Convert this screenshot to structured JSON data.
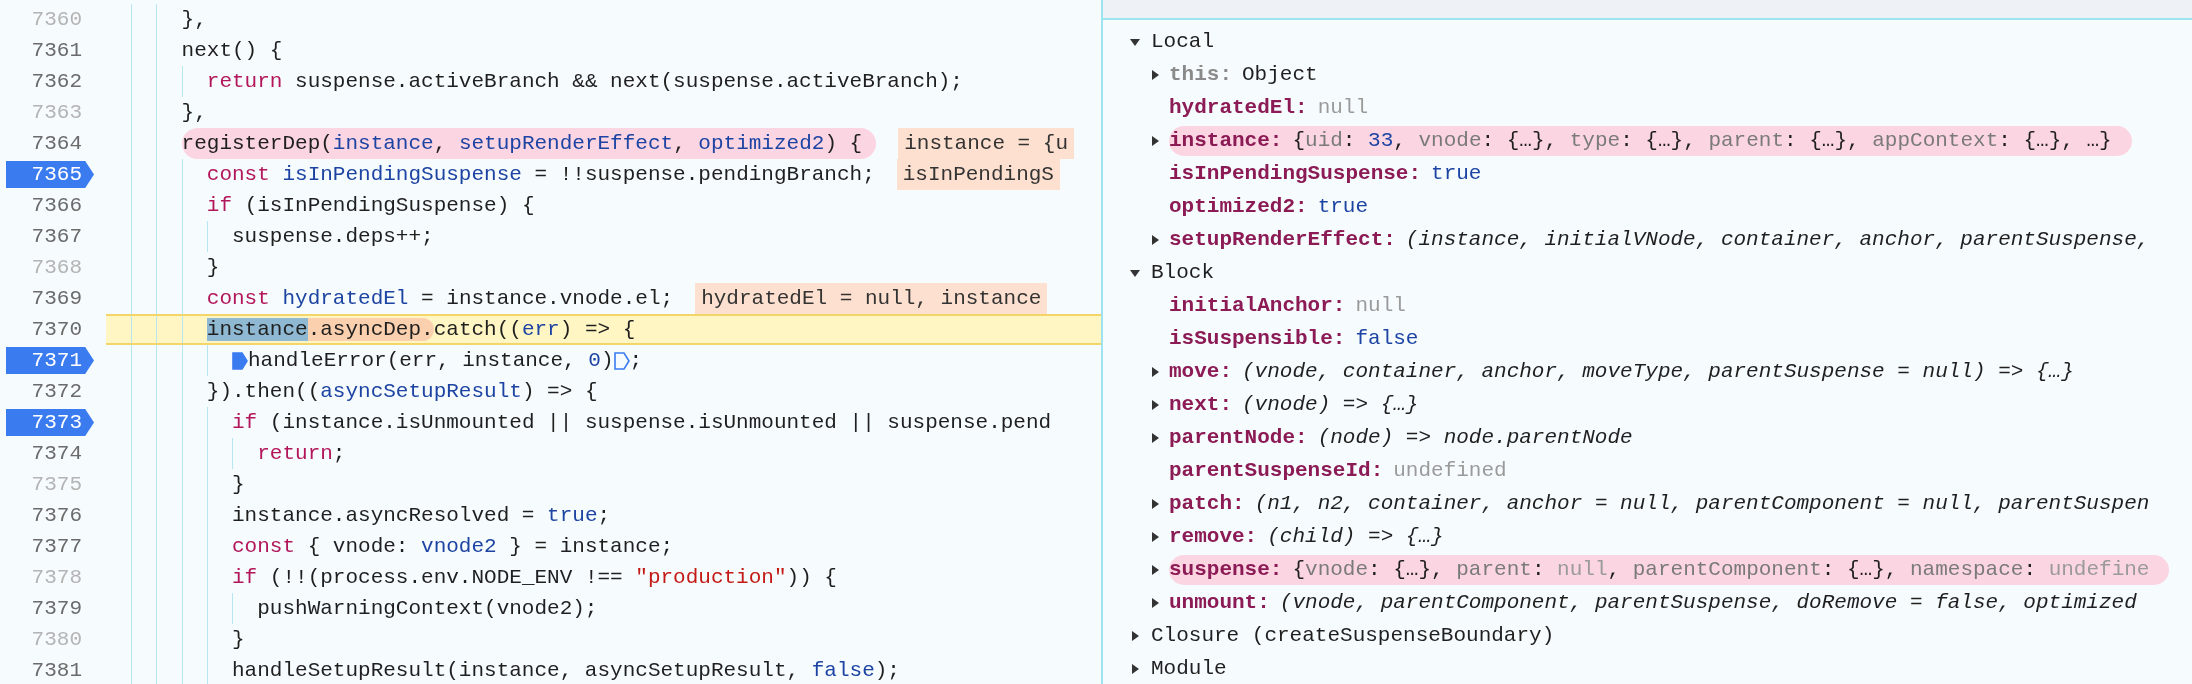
{
  "source": {
    "lines": [
      {
        "number": "7360",
        "breakable": false,
        "breakpoint": false,
        "current": false,
        "marked": false,
        "tokens": [
          {
            "kind": "plain",
            "text": "},"
          }
        ]
      },
      {
        "number": "7361",
        "breakable": true,
        "breakpoint": false,
        "current": false,
        "marked": false,
        "tokens": [
          {
            "kind": "plain",
            "text": "next() {"
          }
        ],
        "children": [
          {
            "number": "7362",
            "breakable": true,
            "breakpoint": false,
            "current": false,
            "marked": false,
            "tokens": [
              {
                "kind": "keyword",
                "text": "return"
              },
              {
                "kind": "plain",
                "text": " suspense.activeBranch && next(suspense.activeBranch);"
              }
            ]
          }
        ]
      },
      {
        "number": "7363",
        "breakable": false,
        "breakpoint": false,
        "current": false,
        "marked": false,
        "tokens": [
          {
            "kind": "plain",
            "text": "},"
          }
        ]
      },
      {
        "number": "7364",
        "breakable": true,
        "breakpoint": false,
        "current": false,
        "marked": true,
        "inline_value": "instance = {u",
        "tokens": [
          {
            "kind": "plain",
            "text": "registerDep("
          },
          {
            "kind": "def",
            "text": "instance"
          },
          {
            "kind": "plain",
            "text": ", "
          },
          {
            "kind": "def",
            "text": "setupRenderEffect"
          },
          {
            "kind": "plain",
            "text": ", "
          },
          {
            "kind": "def",
            "text": "optimized2"
          },
          {
            "kind": "plain",
            "text": ") {"
          }
        ],
        "children": [
          {
            "number": "7365",
            "breakable": true,
            "breakpoint": true,
            "current": false,
            "marked": false,
            "inline_value": "isInPendingS",
            "tokens": [
              {
                "kind": "keyword",
                "text": "const "
              },
              {
                "kind": "def",
                "text": "isInPendingSuspense"
              },
              {
                "kind": "plain",
                "text": " = !!suspense.pendingBranch;"
              }
            ]
          },
          {
            "number": "7366",
            "breakable": true,
            "breakpoint": false,
            "current": false,
            "marked": false,
            "tokens": [
              {
                "kind": "keyword",
                "text": "if"
              },
              {
                "kind": "plain",
                "text": " (isInPendingSuspense) {"
              }
            ],
            "children": [
              {
                "number": "7367",
                "breakable": true,
                "breakpoint": false,
                "current": false,
                "marked": false,
                "tokens": [
                  {
                    "kind": "plain",
                    "text": "suspense.deps++;"
                  }
                ]
              }
            ]
          },
          {
            "number": "7368",
            "breakable": false,
            "breakpoint": false,
            "current": false,
            "marked": false,
            "tokens": [
              {
                "kind": "plain",
                "text": "}"
              }
            ]
          },
          {
            "number": "7369",
            "breakable": true,
            "breakpoint": false,
            "current": false,
            "marked": false,
            "inline_value": "hydratedEl = null, instance",
            "tokens": [
              {
                "kind": "keyword",
                "text": "const "
              },
              {
                "kind": "def",
                "text": "hydratedEl"
              },
              {
                "kind": "plain",
                "text": " = instance.vnode.el;"
              }
            ]
          },
          {
            "number": "7370",
            "breakable": true,
            "breakpoint": false,
            "current": true,
            "marked": false,
            "tokens": [
              {
                "kind": "selected",
                "text": "instance"
              },
              {
                "kind": "exec",
                "text": ".asyncDep."
              },
              {
                "kind": "plain",
                "text": "catch(("
              },
              {
                "kind": "def",
                "text": "err"
              },
              {
                "kind": "plain",
                "text": ") => {"
              }
            ],
            "children": [
              {
                "number": "7371",
                "breakable": true,
                "breakpoint": true,
                "current": false,
                "marked": false,
                "tokens": [
                  {
                    "kind": "bp",
                    "active": true
                  },
                  {
                    "kind": "plain",
                    "text": "handleError(err, instance, "
                  },
                  {
                    "kind": "literal",
                    "text": "0"
                  },
                  {
                    "kind": "plain",
                    "text": ")"
                  },
                  {
                    "kind": "bp",
                    "active": false
                  },
                  {
                    "kind": "plain",
                    "text": ";"
                  }
                ]
              }
            ]
          },
          {
            "number": "7372",
            "breakable": true,
            "breakpoint": false,
            "current": false,
            "marked": false,
            "tokens": [
              {
                "kind": "plain",
                "text": "}).then(("
              },
              {
                "kind": "def",
                "text": "asyncSetupResult"
              },
              {
                "kind": "plain",
                "text": ") => {"
              }
            ],
            "children": [
              {
                "number": "7373",
                "breakable": true,
                "breakpoint": true,
                "current": false,
                "marked": false,
                "tokens": [
                  {
                    "kind": "keyword",
                    "text": "if"
                  },
                  {
                    "kind": "plain",
                    "text": " (instance.isUnmounted || suspense.isUnmounted || suspense.pend"
                  }
                ],
                "children": [
                  {
                    "number": "7374",
                    "breakable": true,
                    "breakpoint": false,
                    "current": false,
                    "marked": false,
                    "tokens": [
                      {
                        "kind": "keyword",
                        "text": "return"
                      },
                      {
                        "kind": "plain",
                        "text": ";"
                      }
                    ]
                  }
                ]
              },
              {
                "number": "7375",
                "breakable": false,
                "breakpoint": false,
                "current": false,
                "marked": false,
                "tokens": [
                  {
                    "kind": "plain",
                    "text": "}"
                  }
                ]
              },
              {
                "number": "7376",
                "breakable": true,
                "breakpoint": false,
                "current": false,
                "marked": false,
                "tokens": [
                  {
                    "kind": "plain",
                    "text": "instance.asyncResolved = "
                  },
                  {
                    "kind": "literal",
                    "text": "true"
                  },
                  {
                    "kind": "plain",
                    "text": ";"
                  }
                ]
              },
              {
                "number": "7377",
                "breakable": true,
                "breakpoint": false,
                "current": false,
                "marked": false,
                "tokens": [
                  {
                    "kind": "keyword",
                    "text": "const"
                  },
                  {
                    "kind": "plain",
                    "text": " { vnode: "
                  },
                  {
                    "kind": "def",
                    "text": "vnode2"
                  },
                  {
                    "kind": "plain",
                    "text": " } = instance;"
                  }
                ]
              },
              {
                "number": "7378",
                "breakable": false,
                "breakpoint": false,
                "current": false,
                "marked": false,
                "tokens": [
                  {
                    "kind": "keyword",
                    "text": "if"
                  },
                  {
                    "kind": "plain",
                    "text": " (!!(process.env.NODE_ENV !== "
                  },
                  {
                    "kind": "string",
                    "text": "\"production\""
                  },
                  {
                    "kind": "plain",
                    "text": ")) {"
                  }
                ],
                "children": [
                  {
                    "number": "7379",
                    "breakable": true,
                    "breakpoint": false,
                    "current": false,
                    "marked": false,
                    "tokens": [
                      {
                        "kind": "plain",
                        "text": "pushWarningContext(vnode2);"
                      }
                    ]
                  }
                ]
              },
              {
                "number": "7380",
                "breakable": false,
                "breakpoint": false,
                "current": false,
                "marked": false,
                "tokens": [
                  {
                    "kind": "plain",
                    "text": "}"
                  }
                ]
              },
              {
                "number": "7381",
                "breakable": true,
                "breakpoint": false,
                "current": false,
                "marked": false,
                "tokens": [
                  {
                    "kind": "plain",
                    "text": "handleSetupResult(instance, asyncSetupResult, "
                  },
                  {
                    "kind": "literal",
                    "text": "false"
                  },
                  {
                    "kind": "plain",
                    "text": ");"
                  }
                ]
              }
            ]
          }
        ]
      }
    ]
  },
  "scope": {
    "sections": [
      {
        "label": "Local",
        "expanded": true,
        "items": [
          {
            "name": "this:",
            "dimmed": true,
            "expandable": true,
            "marked": false,
            "value": [
              {
                "kind": "plain",
                "text": "Object"
              }
            ]
          },
          {
            "name": "hydratedEl:",
            "dimmed": false,
            "expandable": false,
            "marked": false,
            "value": [
              {
                "kind": "null",
                "text": "null"
              }
            ]
          },
          {
            "name": "instance:",
            "dimmed": false,
            "expandable": true,
            "marked": true,
            "value": [
              {
                "kind": "plain",
                "text": "{"
              },
              {
                "kind": "key",
                "text": "uid"
              },
              {
                "kind": "plain",
                "text": ": "
              },
              {
                "kind": "number",
                "text": "33"
              },
              {
                "kind": "plain",
                "text": ", "
              },
              {
                "kind": "key",
                "text": "vnode"
              },
              {
                "kind": "plain",
                "text": ": {…}, "
              },
              {
                "kind": "key",
                "text": "type"
              },
              {
                "kind": "plain",
                "text": ": {…}, "
              },
              {
                "kind": "key",
                "text": "parent"
              },
              {
                "kind": "plain",
                "text": ": {…}, "
              },
              {
                "kind": "key",
                "text": "appContext"
              },
              {
                "kind": "plain",
                "text": ": {…}, …}"
              }
            ]
          },
          {
            "name": "isInPendingSuspense:",
            "dimmed": false,
            "expandable": false,
            "marked": false,
            "value": [
              {
                "kind": "number",
                "text": "true"
              }
            ]
          },
          {
            "name": "optimized2:",
            "dimmed": false,
            "expandable": false,
            "marked": false,
            "value": [
              {
                "kind": "number",
                "text": "true"
              }
            ]
          },
          {
            "name": "setupRenderEffect:",
            "dimmed": false,
            "expandable": true,
            "marked": false,
            "value": [
              {
                "kind": "fn",
                "text": "(instance, initialVNode, container, anchor, parentSuspense,"
              }
            ]
          }
        ]
      },
      {
        "label": "Block",
        "expanded": true,
        "items": [
          {
            "name": "initialAnchor:",
            "dimmed": false,
            "expandable": false,
            "marked": false,
            "value": [
              {
                "kind": "null",
                "text": "null"
              }
            ]
          },
          {
            "name": "isSuspensible:",
            "dimmed": false,
            "expandable": false,
            "marked": false,
            "value": [
              {
                "kind": "number",
                "text": "false"
              }
            ]
          },
          {
            "name": "move:",
            "dimmed": false,
            "expandable": true,
            "marked": false,
            "value": [
              {
                "kind": "fn",
                "text": "(vnode, container, anchor, moveType, parentSuspense = null) => {…}"
              }
            ]
          },
          {
            "name": "next:",
            "dimmed": false,
            "expandable": true,
            "marked": false,
            "value": [
              {
                "kind": "fn",
                "text": "(vnode) => {…}"
              }
            ]
          },
          {
            "name": "parentNode:",
            "dimmed": false,
            "expandable": true,
            "marked": false,
            "value": [
              {
                "kind": "fn",
                "text": "(node) => node.parentNode"
              }
            ]
          },
          {
            "name": "parentSuspenseId:",
            "dimmed": false,
            "expandable": false,
            "marked": false,
            "value": [
              {
                "kind": "null",
                "text": "undefined"
              }
            ]
          },
          {
            "name": "patch:",
            "dimmed": false,
            "expandable": true,
            "marked": false,
            "value": [
              {
                "kind": "fn",
                "text": "(n1, n2, container, anchor = null, parentComponent = null, parentSuspen"
              }
            ]
          },
          {
            "name": "remove:",
            "dimmed": false,
            "expandable": true,
            "marked": false,
            "value": [
              {
                "kind": "fn",
                "text": "(child) => {…}"
              }
            ]
          },
          {
            "name": "suspense:",
            "dimmed": false,
            "expandable": true,
            "marked": true,
            "value": [
              {
                "kind": "plain",
                "text": "{"
              },
              {
                "kind": "key",
                "text": "vnode"
              },
              {
                "kind": "plain",
                "text": ": {…}, "
              },
              {
                "kind": "key",
                "text": "parent"
              },
              {
                "kind": "plain",
                "text": ": "
              },
              {
                "kind": "null",
                "text": "null"
              },
              {
                "kind": "plain",
                "text": ", "
              },
              {
                "kind": "key",
                "text": "parentComponent"
              },
              {
                "kind": "plain",
                "text": ": {…}, "
              },
              {
                "kind": "key",
                "text": "namespace"
              },
              {
                "kind": "plain",
                "text": ": "
              },
              {
                "kind": "null",
                "text": "undefine"
              }
            ]
          },
          {
            "name": "unmount:",
            "dimmed": false,
            "expandable": true,
            "marked": false,
            "value": [
              {
                "kind": "fn",
                "text": "(vnode, parentComponent, parentSuspense, doRemove = false, optimized"
              }
            ]
          }
        ]
      },
      {
        "label": "Closure (createSuspenseBoundary)",
        "expanded": false
      },
      {
        "label": "Module",
        "expanded": false
      }
    ]
  }
}
